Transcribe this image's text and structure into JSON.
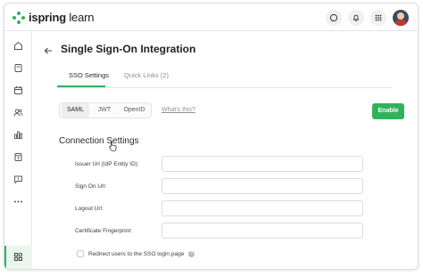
{
  "brand": {
    "name_bold": "ispring",
    "name_light": " learn",
    "accent": "#2eb35c"
  },
  "header": {
    "icons": [
      "help-chat-icon",
      "notifications-bell-icon",
      "apps-grid-icon",
      "user-avatar"
    ]
  },
  "sidebar": {
    "items": [
      "home-icon",
      "courses-icon",
      "calendar-icon",
      "users-icon",
      "reports-icon",
      "catalog-icon",
      "feedback-icon",
      "more-icon",
      "integrations-icon"
    ],
    "active": "integrations-icon"
  },
  "page": {
    "title": "Single Sign-On Integration",
    "tabs": [
      {
        "label": "SSO Settings",
        "active": true
      },
      {
        "label": "Quick Links (2)",
        "active": false
      }
    ],
    "protocols": [
      {
        "label": "SAML",
        "selected": true
      },
      {
        "label": "JWT",
        "selected": false
      },
      {
        "label": "OpenID",
        "selected": false
      }
    ],
    "whats_this": "What's this?",
    "enable_label": "Enable",
    "section_title": "Connection Settings",
    "fields": [
      {
        "label": "Issuer Url (IdP Entity ID):",
        "value": ""
      },
      {
        "label": "Sign On Url:",
        "value": ""
      },
      {
        "label": "Logout Url:",
        "value": ""
      },
      {
        "label": "Certificate Fingerprint:",
        "value": ""
      }
    ],
    "redirect_label": "Redirect users to the SSO login page",
    "redirect_checked": false,
    "help_glyph": "?"
  }
}
